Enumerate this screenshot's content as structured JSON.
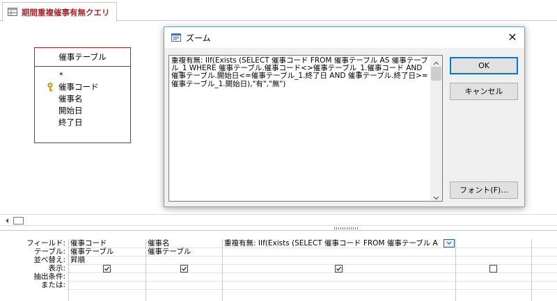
{
  "tab": {
    "title": "期間重複催事有無クエリ",
    "icon": "query-icon"
  },
  "field_list": {
    "table_name": "催事テーブル",
    "fields": [
      "*",
      "催事コード",
      "催事名",
      "開始日",
      "終了日"
    ],
    "primary_key_icon": "key-icon"
  },
  "zoom_dialog": {
    "title": "ズーム",
    "icon": "zoom-window-icon",
    "close_label": "✕",
    "expression": "重複有無: IIf(Exists (SELECT 催事コード FROM 催事テーブル AS 催事テーブル_1 WHERE 催事テーブル.催事コード<>催事テーブル_1.催事コード AND 催事テーブル.開始日<=催事テーブル_1.終了日 AND 催事テーブル.終了日>=催事テーブル_1.開始日),\"有\",\"無\")",
    "ok_label": "OK",
    "cancel_label": "キャンセル",
    "font_label": "フォント(F)..."
  },
  "design_grid": {
    "row_labels": [
      "フィールド:",
      "テーブル:",
      "並べ替え:",
      "表示:",
      "抽出条件:",
      "または:"
    ],
    "columns": [
      {
        "field": "催事コード",
        "table": "催事テーブル",
        "sort": "昇順",
        "show": true
      },
      {
        "field": "催事名",
        "table": "催事テーブル",
        "sort": "",
        "show": true
      },
      {
        "field": "重複有無: IIf(Exists (SELECT 催事コード FROM 催事テーブル A",
        "table": "",
        "sort": "",
        "show": true
      },
      {
        "field": "",
        "table": "",
        "sort": "",
        "show": false
      }
    ]
  },
  "colors": {
    "tab_text": "#a4262c",
    "field_list_border": "#b21f1f",
    "dialog_accent": "#0078d7"
  }
}
